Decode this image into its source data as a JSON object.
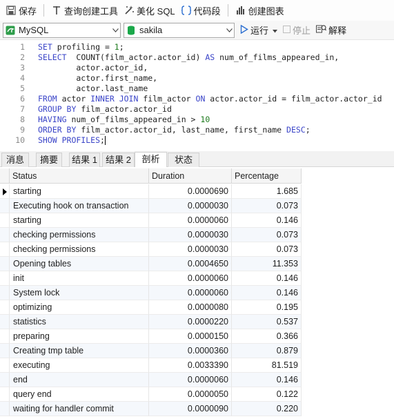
{
  "toolbar": {
    "save_label": "保存",
    "query_builder_label": "查询创建工具",
    "beautify_label": "美化 SQL",
    "snippet_label": "代码段",
    "create_chart_label": "创建图表"
  },
  "connection": {
    "type_value": "MySQL",
    "database_value": "sakila",
    "run_label": "运行",
    "stop_label": "停止",
    "explain_label": "解释"
  },
  "editor": {
    "line_numbers": [
      "1",
      "2",
      "3",
      "4",
      "5",
      "6",
      "7",
      "8",
      "9",
      "10"
    ],
    "lines": [
      [
        {
          "t": "kw",
          "v": "SET"
        },
        {
          "t": "id",
          "v": " profiling = "
        },
        {
          "t": "num",
          "v": "1"
        },
        {
          "t": "id",
          "v": ";"
        }
      ],
      [
        {
          "t": "kw",
          "v": "SELECT"
        },
        {
          "t": "id",
          "v": "  COUNT(film_actor.actor_id) "
        },
        {
          "t": "kw",
          "v": "AS"
        },
        {
          "t": "id",
          "v": " num_of_films_appeared_in,"
        }
      ],
      [
        {
          "t": "id",
          "v": "        actor.actor_id,"
        }
      ],
      [
        {
          "t": "id",
          "v": "        actor.first_name,"
        }
      ],
      [
        {
          "t": "id",
          "v": "        actor.last_name"
        }
      ],
      [
        {
          "t": "kw",
          "v": "FROM"
        },
        {
          "t": "id",
          "v": " actor "
        },
        {
          "t": "kw",
          "v": "INNER JOIN"
        },
        {
          "t": "id",
          "v": " film_actor "
        },
        {
          "t": "kw",
          "v": "ON"
        },
        {
          "t": "id",
          "v": " actor.actor_id = film_actor.actor_id"
        }
      ],
      [
        {
          "t": "kw",
          "v": "GROUP BY"
        },
        {
          "t": "id",
          "v": " film_actor.actor_id"
        }
      ],
      [
        {
          "t": "kw",
          "v": "HAVING"
        },
        {
          "t": "id",
          "v": " num_of_films_appeared_in > "
        },
        {
          "t": "num",
          "v": "10"
        }
      ],
      [
        {
          "t": "kw",
          "v": "ORDER BY"
        },
        {
          "t": "id",
          "v": " film_actor.actor_id, last_name, first_name "
        },
        {
          "t": "kw",
          "v": "DESC"
        },
        {
          "t": "id",
          "v": ";"
        }
      ],
      [
        {
          "t": "kw",
          "v": "SHOW PROFILES"
        },
        {
          "t": "id",
          "v": ";"
        }
      ]
    ]
  },
  "tabs": [
    "消息",
    "摘要",
    "结果 1",
    "结果 2",
    "剖析",
    "状态"
  ],
  "active_tab": "剖析",
  "grid": {
    "headers": [
      "Status",
      "Duration",
      "Percentage"
    ],
    "rows": [
      [
        "starting",
        "0.0000690",
        "1.685"
      ],
      [
        "Executing hook on transaction",
        "0.0000030",
        "0.073"
      ],
      [
        "starting",
        "0.0000060",
        "0.146"
      ],
      [
        "checking permissions",
        "0.0000030",
        "0.073"
      ],
      [
        "checking permissions",
        "0.0000030",
        "0.073"
      ],
      [
        "Opening tables",
        "0.0004650",
        "11.353"
      ],
      [
        "init",
        "0.0000060",
        "0.146"
      ],
      [
        "System lock",
        "0.0000060",
        "0.146"
      ],
      [
        "optimizing",
        "0.0000080",
        "0.195"
      ],
      [
        "statistics",
        "0.0000220",
        "0.537"
      ],
      [
        "preparing",
        "0.0000150",
        "0.366"
      ],
      [
        "Creating tmp table",
        "0.0000360",
        "0.879"
      ],
      [
        "executing",
        "0.0033390",
        "81.519"
      ],
      [
        "end",
        "0.0000060",
        "0.146"
      ],
      [
        "query end",
        "0.0000050",
        "0.122"
      ],
      [
        "waiting for handler commit",
        "0.0000090",
        "0.220"
      ]
    ]
  },
  "colors": {
    "keyword": "#3a44c8",
    "number": "#1d7a1d",
    "database_icon": "#1aa84a",
    "run_icon": "#2d6fd1"
  }
}
